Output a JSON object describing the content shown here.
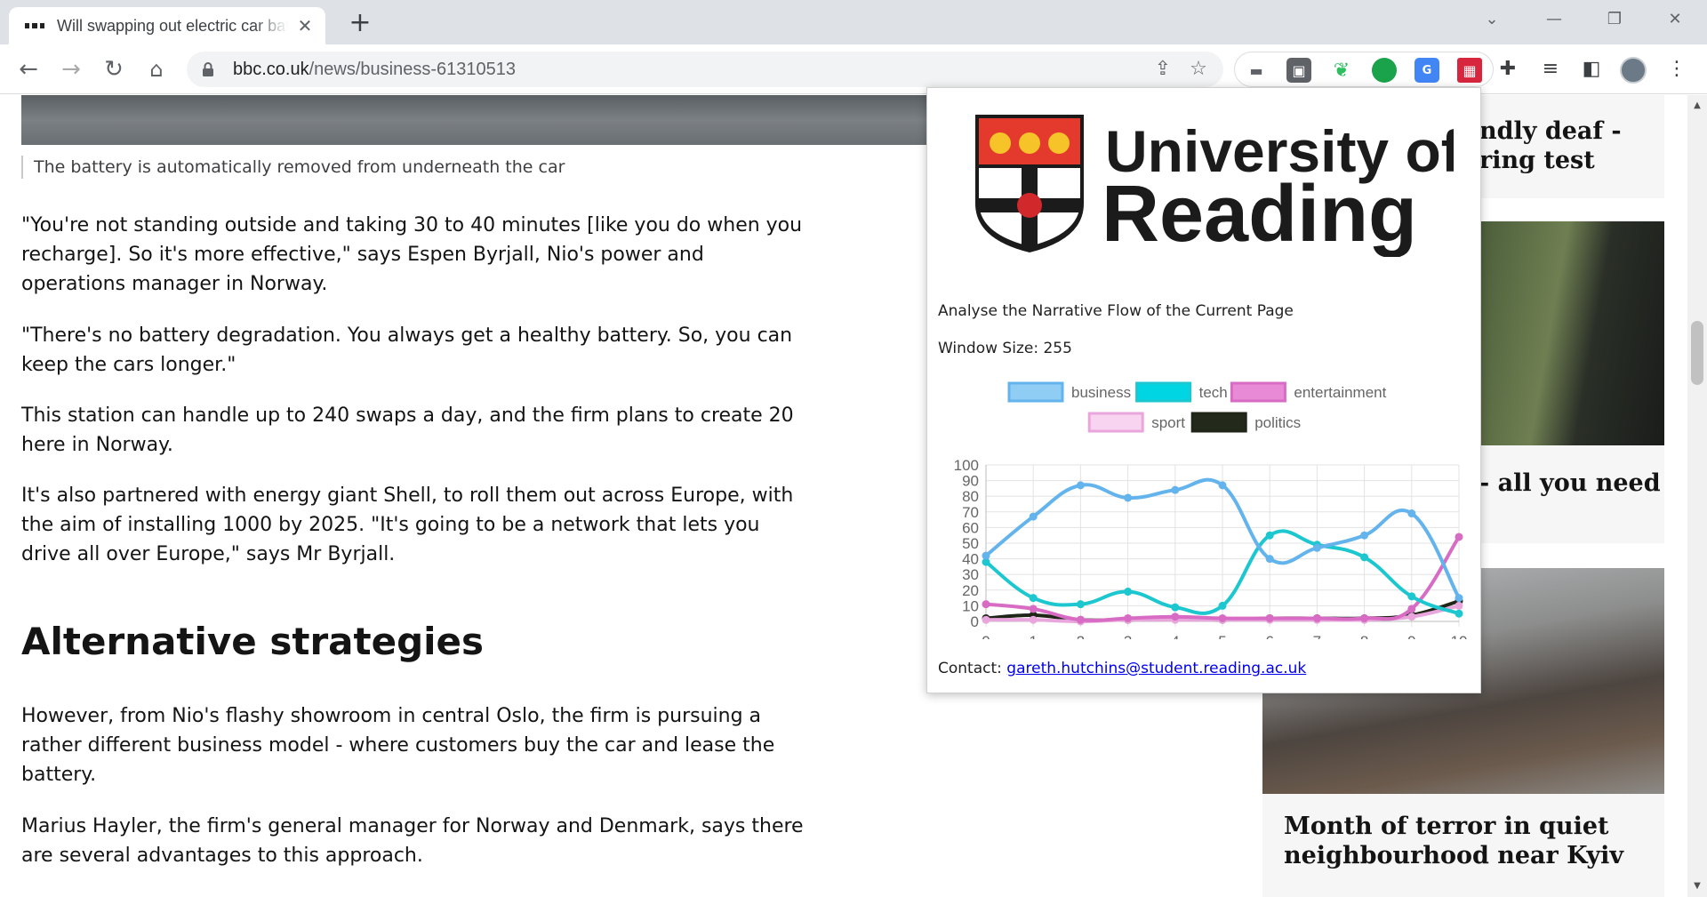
{
  "browser": {
    "tab_title": "Will swapping out electric car batteries catch on?",
    "url_host": "bbc.co.uk",
    "url_path": "/news/business-61310513"
  },
  "article": {
    "caption": "The battery is automatically removed from underneath the car",
    "paragraphs": [
      "\"You're not standing outside and taking 30 to 40 minutes [like you do when you recharge]. So it's more effective,\" says Espen Byrjall, Nio's power and operations manager in Norway.",
      "\"There's no battery degradation. You always get a healthy battery. So, you can keep the cars longer.\"",
      "This station can handle up to 240 swaps a day, and the firm plans to create 20 here in Norway.",
      "It's also partnered with energy giant Shell, to roll them out across Europe, with the aim of installing 1000 by 2025. \"It's going to be a network that lets you drive all over Europe,\" says Mr Byrjall.",
      "However, from Nio's flashy showroom in central Oslo, the firm is pursuing a rather different business model - where customers buy the car and lease the battery.",
      "Marius Hayler, the firm's general manager for Norway and Denmark, says there are several advantages to this approach."
    ],
    "heading": "Alternative strategies"
  },
  "sidebar": {
    "card1_title_line1": "ndly deaf -",
    "card1_title_line2": "ring test",
    "card2_title": "- all you need",
    "card3_title_line1": "Month of terror in quiet",
    "card3_title_line2": "neighbourhood near Kyiv"
  },
  "popup": {
    "logo_line1": "University of",
    "logo_line2": "Reading",
    "description": "Analyse the Narrative Flow of the Current Page",
    "window_size_label": "Window Size: 255",
    "contact_label": "Contact:",
    "contact_email": "gareth.hutchins@student.reading.ac.uk"
  },
  "chart_data": {
    "type": "line",
    "x": [
      0,
      1,
      2,
      3,
      4,
      5,
      6,
      7,
      8,
      9,
      10
    ],
    "ylim": [
      0,
      100
    ],
    "yticks": [
      0,
      10,
      20,
      30,
      40,
      50,
      60,
      70,
      80,
      90,
      100
    ],
    "legend_position": "top",
    "series": [
      {
        "name": "business",
        "color": "#63b3ed",
        "fill": "#90cdf4",
        "values": [
          42,
          67,
          87,
          79,
          84,
          87,
          40,
          47,
          55,
          69,
          15
        ]
      },
      {
        "name": "tech",
        "color": "#1cc7d0",
        "fill": "#00d5e3",
        "values": [
          38,
          15,
          11,
          19,
          9,
          10,
          55,
          49,
          41,
          16,
          5
        ]
      },
      {
        "name": "entertainment",
        "color": "#d86cc4",
        "fill": "#e88ad5",
        "values": [
          11,
          8,
          1,
          2,
          3,
          2,
          2,
          2,
          2,
          8,
          54
        ]
      },
      {
        "name": "sport",
        "color": "#e9a6dc",
        "fill": "#f8d4f0",
        "values": [
          1,
          1,
          0,
          1,
          1,
          1,
          1,
          1,
          1,
          3,
          10
        ]
      },
      {
        "name": "politics",
        "color": "#1f2617",
        "fill": "#232a1c",
        "values": [
          2,
          4,
          1,
          1,
          2,
          1,
          2,
          2,
          2,
          4,
          13
        ]
      }
    ]
  }
}
